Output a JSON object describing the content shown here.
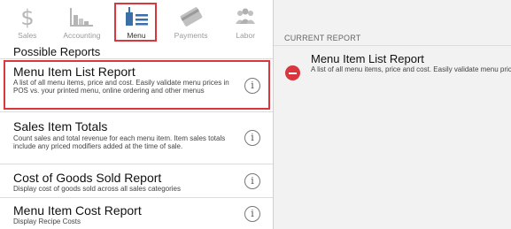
{
  "tabs": [
    {
      "label": "Sales",
      "icon": "dollar-icon"
    },
    {
      "label": "Accounting",
      "icon": "bar-chart-icon"
    },
    {
      "label": "Menu",
      "icon": "menu-icon",
      "active": true
    },
    {
      "label": "Payments",
      "icon": "credit-card-icon"
    },
    {
      "label": "Labor",
      "icon": "people-icon"
    }
  ],
  "left": {
    "section_title": "Possible Reports",
    "reports": [
      {
        "title": "Menu Item List Report",
        "desc": "A list of all menu items, price and cost. Easily validate menu prices in POS vs. your printed menu, online ordering and other menus",
        "selected": true
      },
      {
        "title": "Sales Item Totals",
        "desc": "Count sales and total revenue for each menu item. Item sales totals include any priced modifiers added at the time of sale."
      },
      {
        "title": "Cost of Goods Sold Report",
        "desc": "Display cost of goods sold across all sales categories"
      },
      {
        "title": "Menu Item Cost Report",
        "desc": "Display Recipe Costs"
      }
    ]
  },
  "right": {
    "section_label": "CURRENT REPORT",
    "current": {
      "title": "Menu Item List Report",
      "desc": "A list of all menu items, price and cost. Easily validate menu prices in POS vs. your printed menu, online ordering and other menus"
    }
  },
  "colors": {
    "highlight": "#d9363e",
    "remove": "#d9363e",
    "right_bg": "#f2f2f2"
  }
}
